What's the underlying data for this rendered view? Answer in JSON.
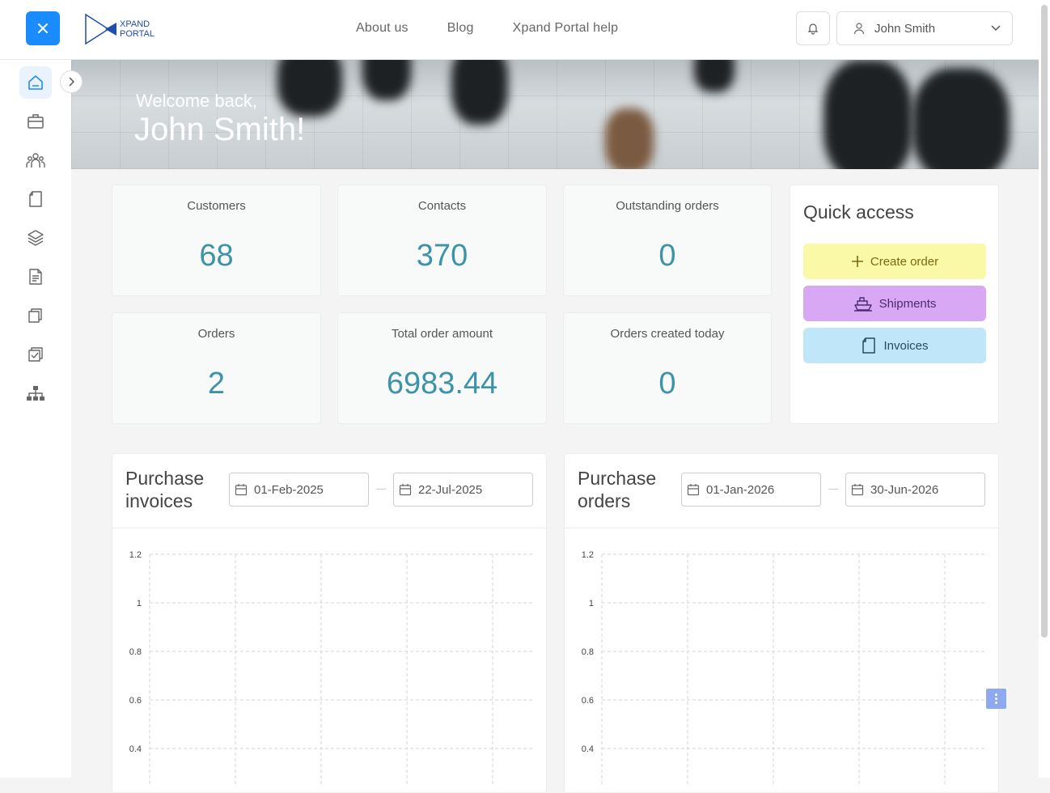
{
  "header": {
    "logo_line1": "XPAND",
    "logo_line2": "PORTAL",
    "nav": [
      "About us",
      "Blog",
      "Xpand Portal help"
    ],
    "user_name": "John Smith"
  },
  "banner": {
    "welcome": "Welcome back,",
    "name": "John Smith!"
  },
  "stats": [
    {
      "label": "Customers",
      "value": "68"
    },
    {
      "label": "Contacts",
      "value": "370"
    },
    {
      "label": "Outstanding orders",
      "value": "0"
    },
    {
      "label": "Orders",
      "value": "2"
    },
    {
      "label": "Total order amount",
      "value": "6983.44"
    },
    {
      "label": "Orders created today",
      "value": "0"
    }
  ],
  "quick_access": {
    "title": "Quick access",
    "buttons": [
      {
        "label": "Create order",
        "color": "#f9f9a8",
        "text_color": "#7a6a10"
      },
      {
        "label": "Shipments",
        "color": "#d9a8f5",
        "text_color": "#4a2a70"
      },
      {
        "label": "Invoices",
        "color": "#bfe6f9",
        "text_color": "#2a4a60"
      }
    ]
  },
  "panels": [
    {
      "title": "Purchase invoices",
      "date_from": "01-Feb-2025",
      "date_to": "22-Jul-2025"
    },
    {
      "title": "Purchase orders",
      "date_from": "01-Jan-2026",
      "date_to": "30-Jun-2026"
    }
  ],
  "chart_data": [
    {
      "type": "line",
      "title": "Purchase invoices",
      "y_ticks": [
        "1.2",
        "1",
        "0.8",
        "0.6",
        "0.4"
      ],
      "ylim": [
        0.4,
        1.2
      ],
      "grid": true,
      "series": []
    },
    {
      "type": "line",
      "title": "Purchase orders",
      "y_ticks": [
        "1.2",
        "1",
        "0.8",
        "0.6",
        "0.4"
      ],
      "ylim": [
        0.4,
        1.2
      ],
      "grid": true,
      "series": []
    }
  ],
  "colors": {
    "accent": "#1a8cff",
    "stat_value": "#3d93a8"
  },
  "sidebar_icons": [
    "home-icon",
    "briefcase-icon",
    "people-icon",
    "document-icon",
    "layers-icon",
    "file-text-icon",
    "folders-icon",
    "checklist-icon",
    "sitemap-icon"
  ]
}
